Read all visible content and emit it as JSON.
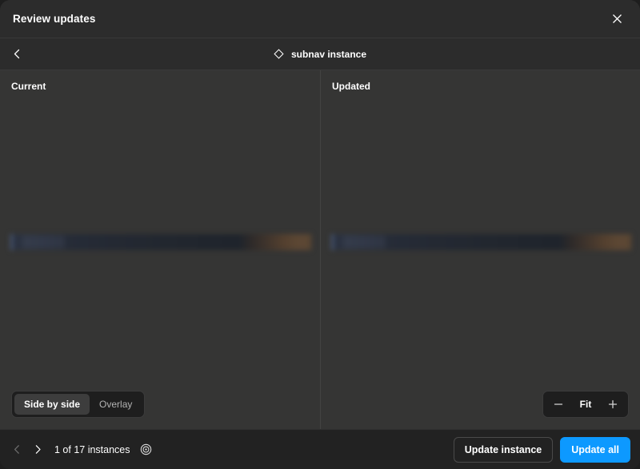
{
  "window": {
    "title": "Review updates",
    "close_icon": "close-icon"
  },
  "subheader": {
    "back_icon": "chevron-left-icon",
    "component_icon": "component-instance-diamond-icon",
    "label": "subnav instance"
  },
  "compare": {
    "panes": [
      {
        "label": "Current",
        "name": "current"
      },
      {
        "label": "Updated",
        "name": "updated"
      }
    ]
  },
  "view_mode": {
    "options": [
      {
        "label": "Side by side",
        "active": true
      },
      {
        "label": "Overlay",
        "active": false
      }
    ]
  },
  "zoom_controls": {
    "minus_icon": "minus-icon",
    "level": "Fit",
    "plus_icon": "plus-icon"
  },
  "footer": {
    "prev_icon": "chevron-left-icon",
    "next_icon": "chevron-right-icon",
    "instance_count": "1 of 17 instances",
    "target_icon": "target-icon",
    "update_instance_label": "Update instance",
    "update_all_label": "Update all"
  },
  "colors": {
    "accent": "#0d99ff",
    "window_bg": "#2c2c2c",
    "canvas_bg": "#353534",
    "footer_bg": "#222222",
    "text_primary": "#ffffff",
    "text_secondary": "#b3b3b3"
  }
}
